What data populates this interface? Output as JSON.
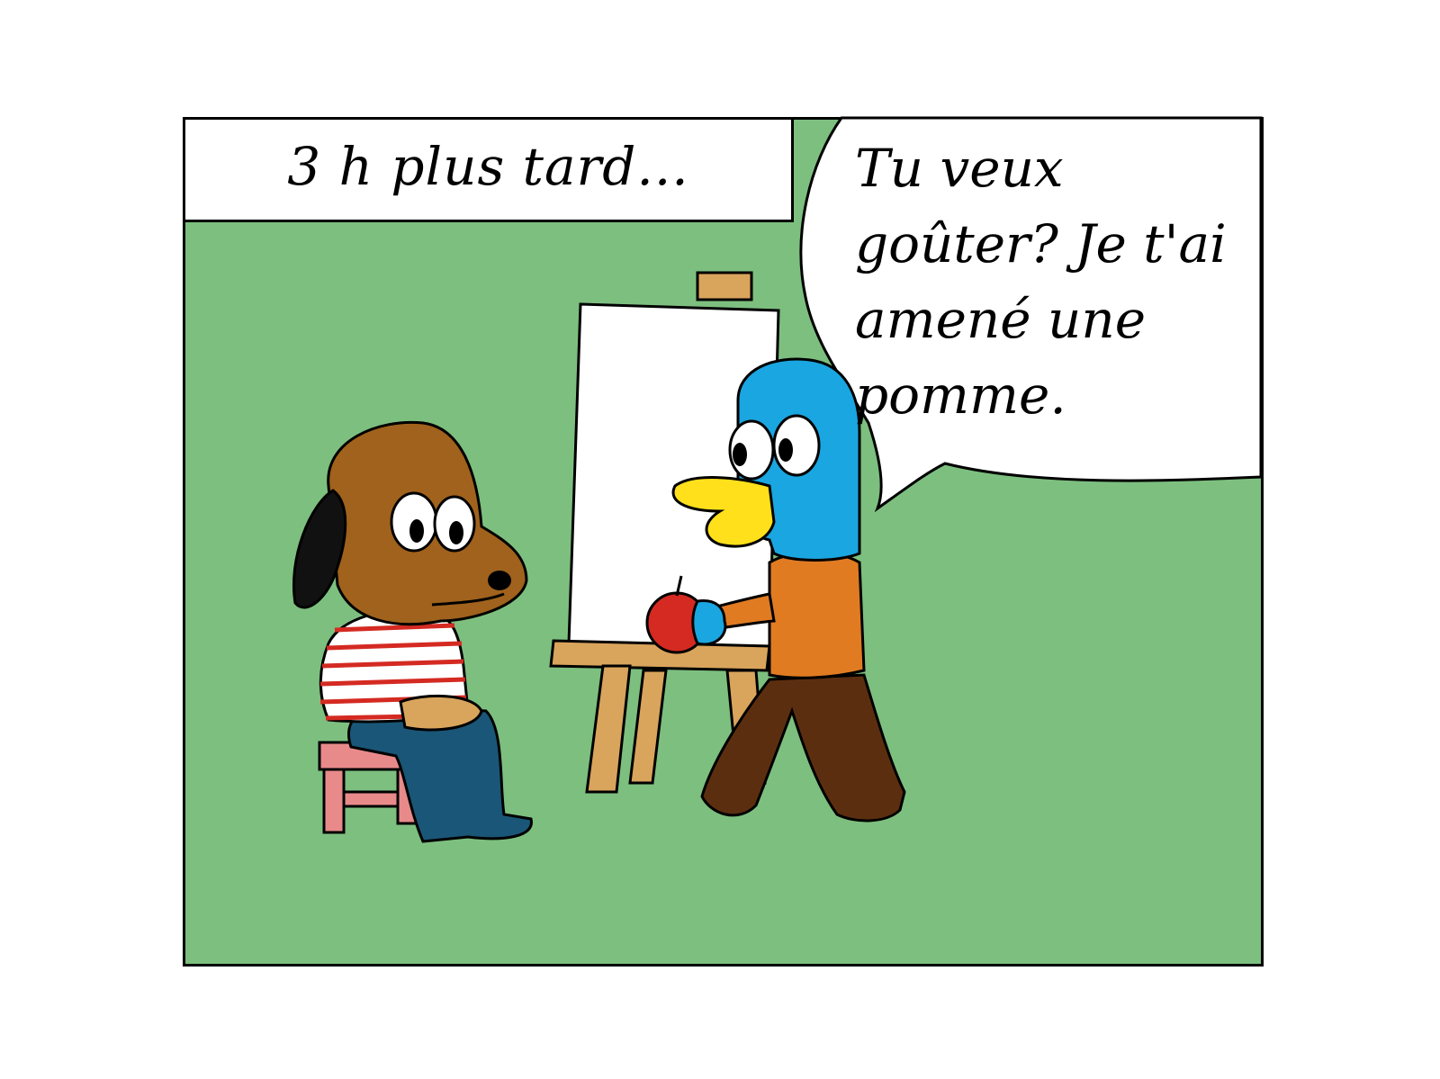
{
  "caption": {
    "text": "3 h plus tard..."
  },
  "speech_bubble": {
    "text": "Tu veux goûter? Je t'ai amené une pomme."
  },
  "characters": {
    "dog": {
      "label": "dog",
      "shirt": "red-white stripes"
    },
    "duck": {
      "label": "duck",
      "holding": "apple"
    }
  },
  "colors": {
    "background": "#7dbf7f",
    "dog_head": "#a0621c",
    "duck_head": "#1aa6e0",
    "duck_shirt": "#e07b22",
    "apple": "#d42a22",
    "easel": "#d9a45c",
    "stool": "#e88a8a"
  }
}
